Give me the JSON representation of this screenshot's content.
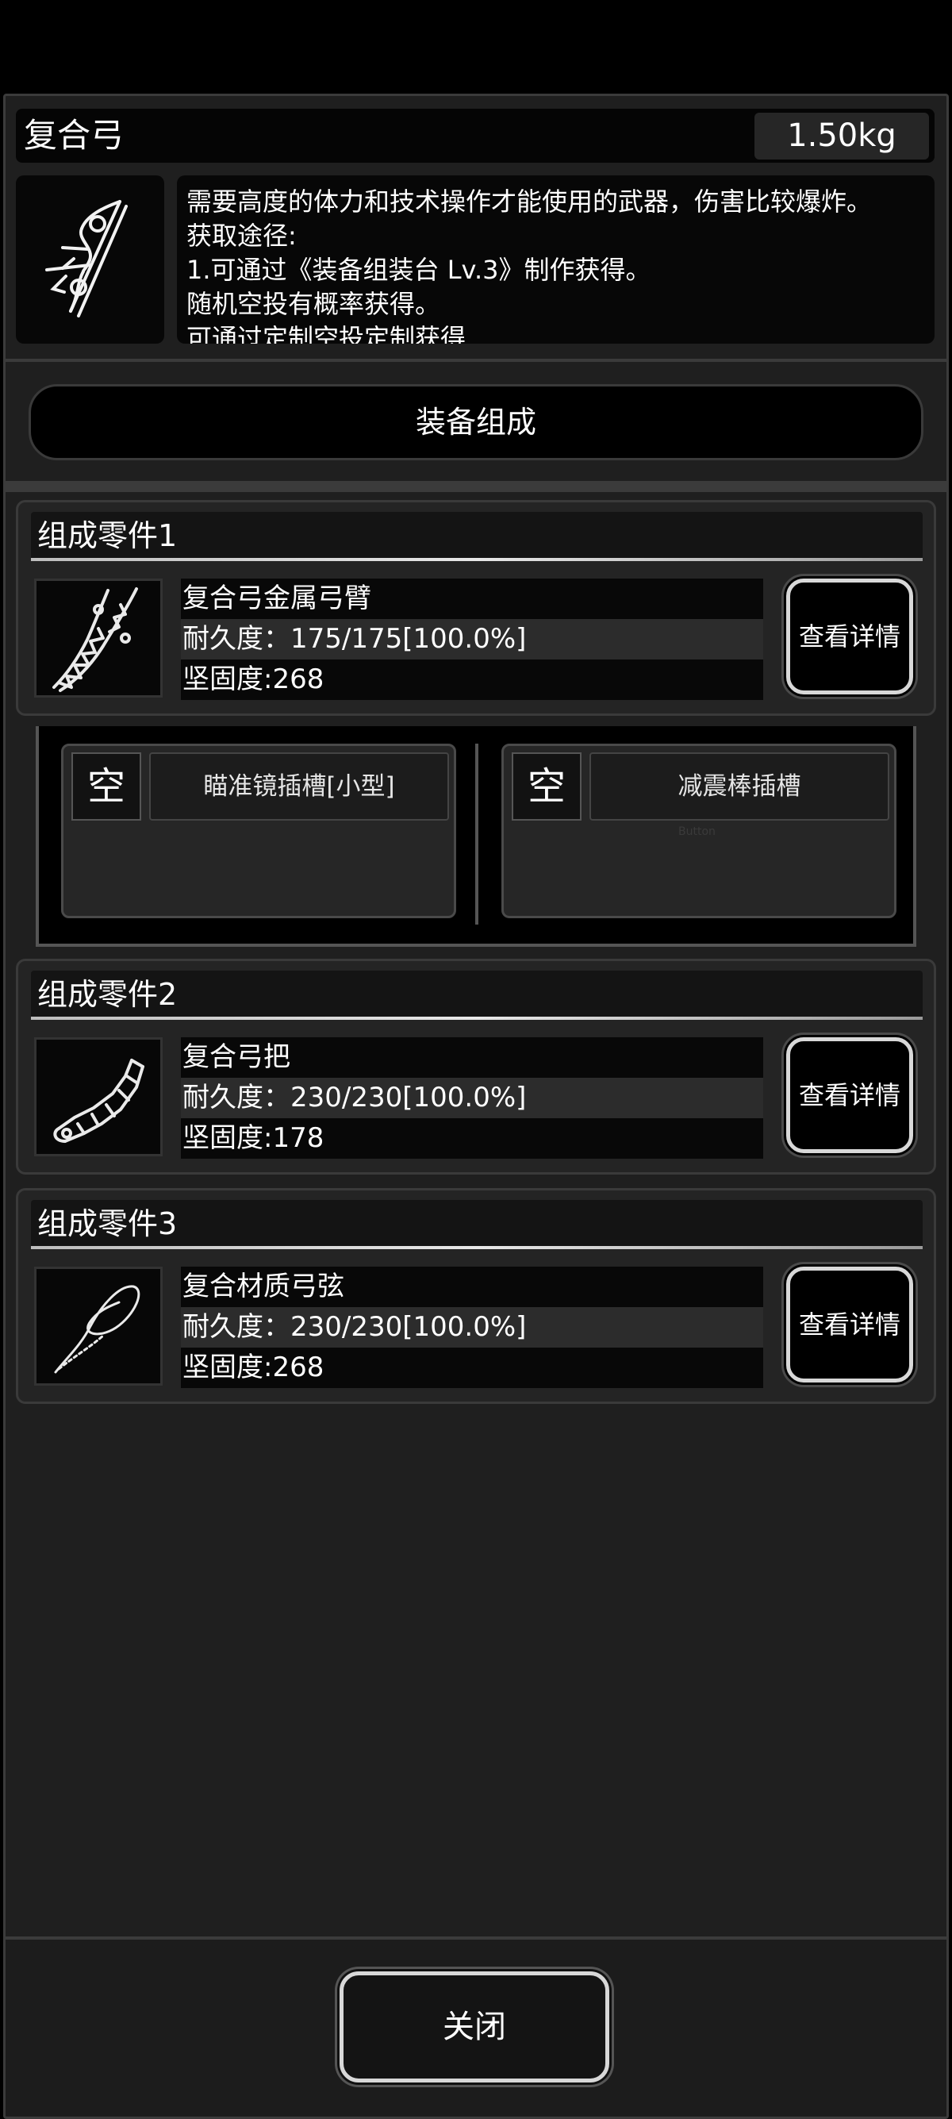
{
  "item": {
    "name": "复合弓",
    "weight": "1.50kg",
    "icon": "compound-bow-icon",
    "description": [
      "需要高度的体力和技术操作才能使用的武器，伤害比较爆炸。",
      "获取途径:",
      "1.可通过《装备组装台 Lv.3》制作获得。",
      "随机空投有概率获得。",
      "可通过定制空投定制获得"
    ]
  },
  "assembly_label": "装备组成",
  "parts": [
    {
      "title": "组成零件1",
      "icon": "bow-limb-icon",
      "name": "复合弓金属弓臂",
      "durability": "耐久度：175/175[100.0%]",
      "hardness": "坚固度:268",
      "detail_label": "查看详情"
    },
    {
      "title": "组成零件2",
      "icon": "bow-grip-icon",
      "name": "复合弓把",
      "durability": "耐久度：230/230[100.0%]",
      "hardness": "坚固度:178",
      "detail_label": "查看详情"
    },
    {
      "title": "组成零件3",
      "icon": "bow-string-icon",
      "name": "复合材质弓弦",
      "durability": "耐久度：230/230[100.0%]",
      "hardness": "坚固度:268",
      "detail_label": "查看详情"
    }
  ],
  "slots": [
    {
      "status": "空",
      "name": "瞄准镜插槽[小型]"
    },
    {
      "status": "空",
      "name": "减震棒插槽",
      "hint": "Button"
    }
  ],
  "close_label": "关闭",
  "colors": {
    "panel_bg": "#1f1f1f",
    "frame_border": "#3b3b3b",
    "text": "#ffffff",
    "button_border": "#d8d8d8"
  }
}
